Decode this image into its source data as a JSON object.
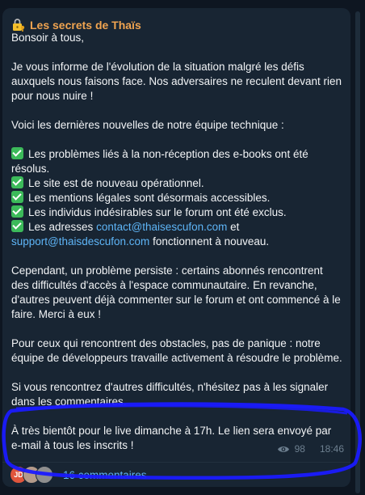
{
  "channel": {
    "name": "Les secrets de Thaïs",
    "icon": "lock-key-icon"
  },
  "message": {
    "greeting": "Bonsoir à tous,",
    "intro": "Je vous informe de l'évolution de la situation malgré les défis auxquels nous faisons face. Nos adversaires ne reculent devant rien pour nous nuire !",
    "news_heading": "Voici les dernières nouvelles de notre équipe technique :",
    "checklist": [
      "Les problèmes liés à la non-réception des e-books ont été résolus.",
      "Le site est de nouveau opérationnel.",
      "Les mentions légales sont désormais accessibles.",
      "Les individus indésirables sur le forum ont été exclus."
    ],
    "addresses": {
      "prefix": "Les adresses",
      "email1": "contact@thaisescufon.com",
      "conjunction": "et",
      "email2": "support@thaisdescufon.com",
      "suffix": "fonctionnent à nouveau."
    },
    "problem": "Cependant, un problème persiste : certains abonnés rencontrent des difficultés d'accès à l'espace communautaire. En revanche, d'autres peuvent déjà commenter sur le forum et ont commencé à le faire. Merci à eux !",
    "obstacles": "Pour ceux qui rencontrent des obstacles, pas de panique : notre équipe de développeurs travaille activement à résoudre le problème.",
    "report": "Si vous rencontrez d'autres difficultés, n'hésitez pas à les signaler dans les commentaires.",
    "closing": "À très bientôt pour le live dimanche à 17h. Le lien sera envoyé par e-mail à tous les inscrits !"
  },
  "meta": {
    "views": "98",
    "time": "18:46"
  },
  "comments": {
    "avatars": [
      "JD",
      "",
      ""
    ],
    "label": "16 commentaires"
  },
  "colors": {
    "background": "#0e1621",
    "bubble": "#182533",
    "channel_name": "#f0a450",
    "link": "#5eb5f7",
    "check": "#3cba5a",
    "annotation_ring": "#1a1aff"
  }
}
